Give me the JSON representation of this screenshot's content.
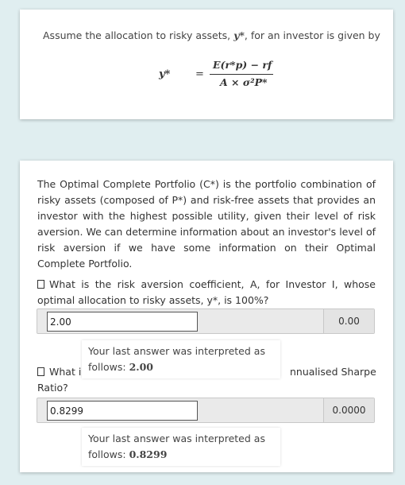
{
  "card1": {
    "intro_before": "Assume the allocation to risky assets, ",
    "intro_symbol": "y*",
    "intro_after": ", for an investor is given by",
    "formula": {
      "lhs": "y*",
      "equals": "=",
      "numerator": "E(r*p) − rf",
      "denominator": "A × σ²P*"
    }
  },
  "card2": {
    "paragraph": "The Optimal Complete Portfolio (C*) is the portfolio combination of risky assets (composed of P*) and risk-free assets that provides an investor with the highest possible utility, given their level of risk aversion. We can determine information about an investor's level of risk aversion if we have some information on their Optimal Complete Portfolio.",
    "question1": "What is the risk aversion coefficient, A, for Investor I, whose optimal allocation to risky assets, y*, is 100%?",
    "answer1": {
      "value": "2.00",
      "score": "0.00"
    },
    "interp1": {
      "prefix": "Your last answer was interpreted as follows: ",
      "value": "2.00"
    },
    "question2_start": "What i",
    "question2_end": "nnualised Sharpe",
    "question2_tail": "Ratio?",
    "answer2": {
      "value": "0.8299",
      "score": "0.0000"
    },
    "interp2": {
      "prefix": "Your last answer was interpreted as follows: ",
      "value": "0.8299"
    }
  }
}
